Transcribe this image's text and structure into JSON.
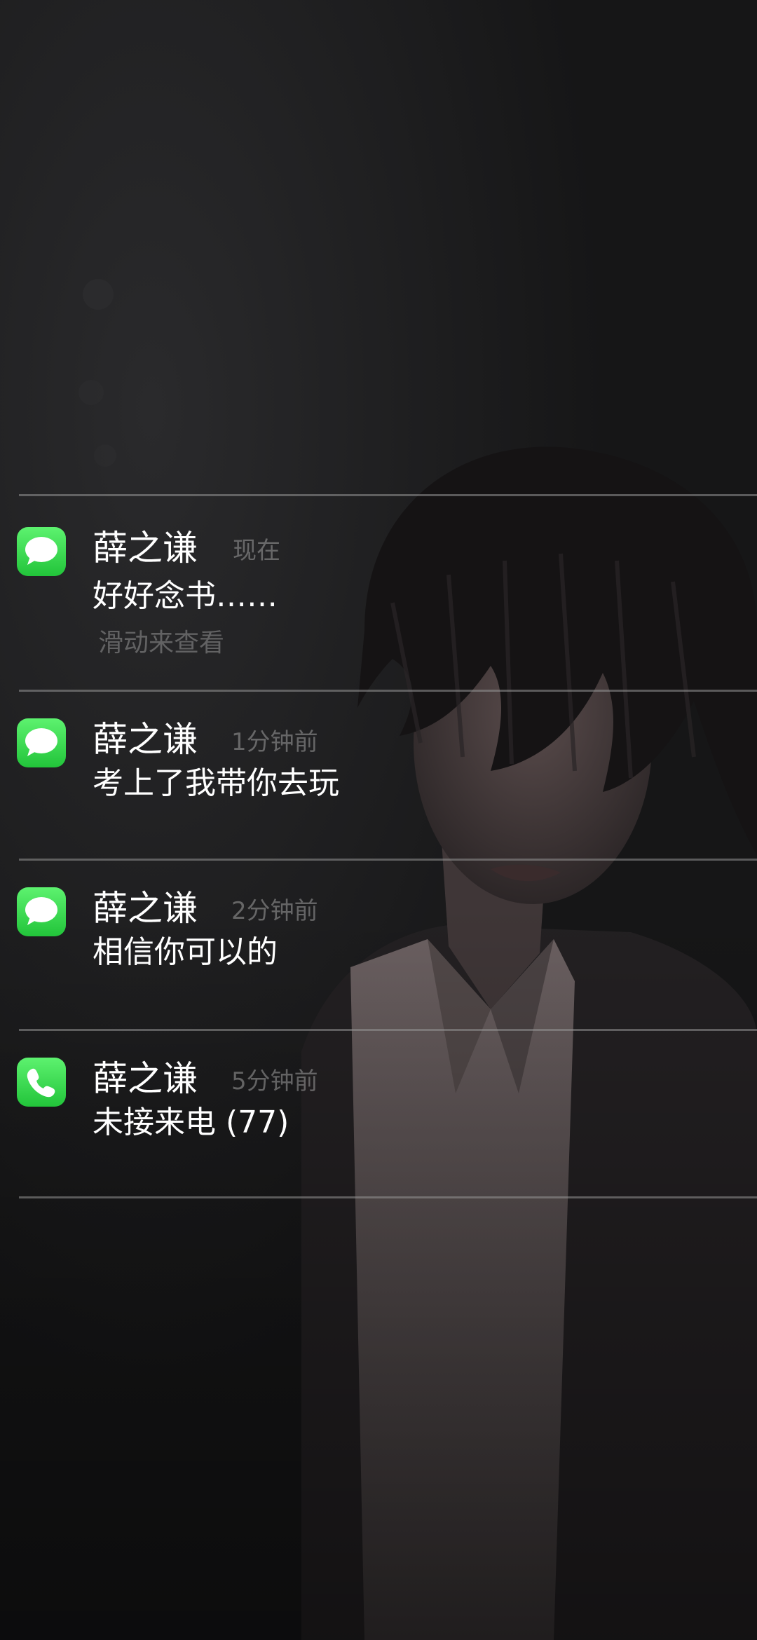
{
  "notifications": [
    {
      "app_icon": "messages-icon",
      "sender": "薛之谦",
      "time": "现在",
      "body": "好好念书……",
      "hint": "滑动来查看"
    },
    {
      "app_icon": "messages-icon",
      "sender": "薛之谦",
      "time": "1分钟前",
      "body": "考上了我带你去玩"
    },
    {
      "app_icon": "messages-icon",
      "sender": "薛之谦",
      "time": "2分钟前",
      "body": "相信你可以的"
    },
    {
      "app_icon": "phone-icon",
      "sender": "薛之谦",
      "time": "5分钟前",
      "body": "未接来电 (77)"
    }
  ],
  "colors": {
    "background": "#1c1c1e",
    "app_icon_green": "#34c759",
    "text_primary": "#ffffff",
    "text_secondary": "#8e8e93"
  }
}
